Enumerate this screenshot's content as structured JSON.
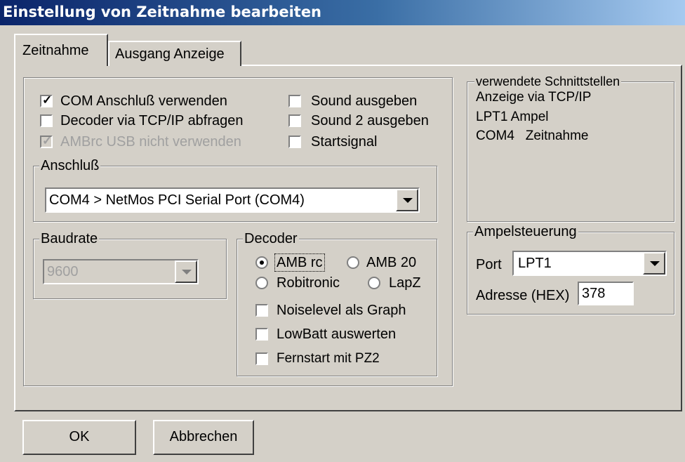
{
  "window": {
    "title": "Einstellung von Zeitnahme bearbeiten"
  },
  "tabs": [
    {
      "label": "Zeitnahme"
    },
    {
      "label": "Ausgang Anzeige"
    }
  ],
  "checkboxes": {
    "com": {
      "label": "COM Anschluß verwenden",
      "checked": true
    },
    "tcp": {
      "label": "Decoder via TCP/IP abfragen",
      "checked": false
    },
    "ambrc_usb": {
      "label": "AMBrc USB nicht verwenden",
      "checked": true,
      "disabled": true
    },
    "sound": {
      "label": "Sound ausgeben",
      "checked": false
    },
    "sound2": {
      "label": "Sound 2 ausgeben",
      "checked": false
    },
    "start": {
      "label": "Startsignal",
      "checked": false
    }
  },
  "anschluss": {
    "legend": "Anschluß",
    "value": "COM4 > NetMos PCI Serial Port (COM4)"
  },
  "baudrate": {
    "legend": "Baudrate",
    "value": "9600"
  },
  "decoder": {
    "legend": "Decoder",
    "options": [
      {
        "label": "AMB rc",
        "selected": true
      },
      {
        "label": "AMB 20",
        "selected": false
      },
      {
        "label": "Robitronic",
        "selected": false
      },
      {
        "label": "LapZ",
        "selected": false
      }
    ],
    "noiselevel": {
      "label": "Noiselevel als Graph",
      "checked": false
    },
    "lowbatt": {
      "label": "LowBatt auswerten",
      "checked": false
    },
    "fernstart": {
      "label": "Fernstart mit PZ2",
      "checked": false
    }
  },
  "schnittstellen": {
    "legend": "verwendete Schnittstellen",
    "lines": [
      "Anzeige via TCP/IP",
      "LPT1 Ampel",
      "COM4   Zeitnahme"
    ]
  },
  "ampel": {
    "legend": "Ampelsteuerung",
    "port_label": "Port",
    "port_value": "LPT1",
    "adresse_label": "Adresse (HEX)",
    "adresse_value": "378"
  },
  "buttons": {
    "ok": "OK",
    "cancel": "Abbrechen"
  }
}
